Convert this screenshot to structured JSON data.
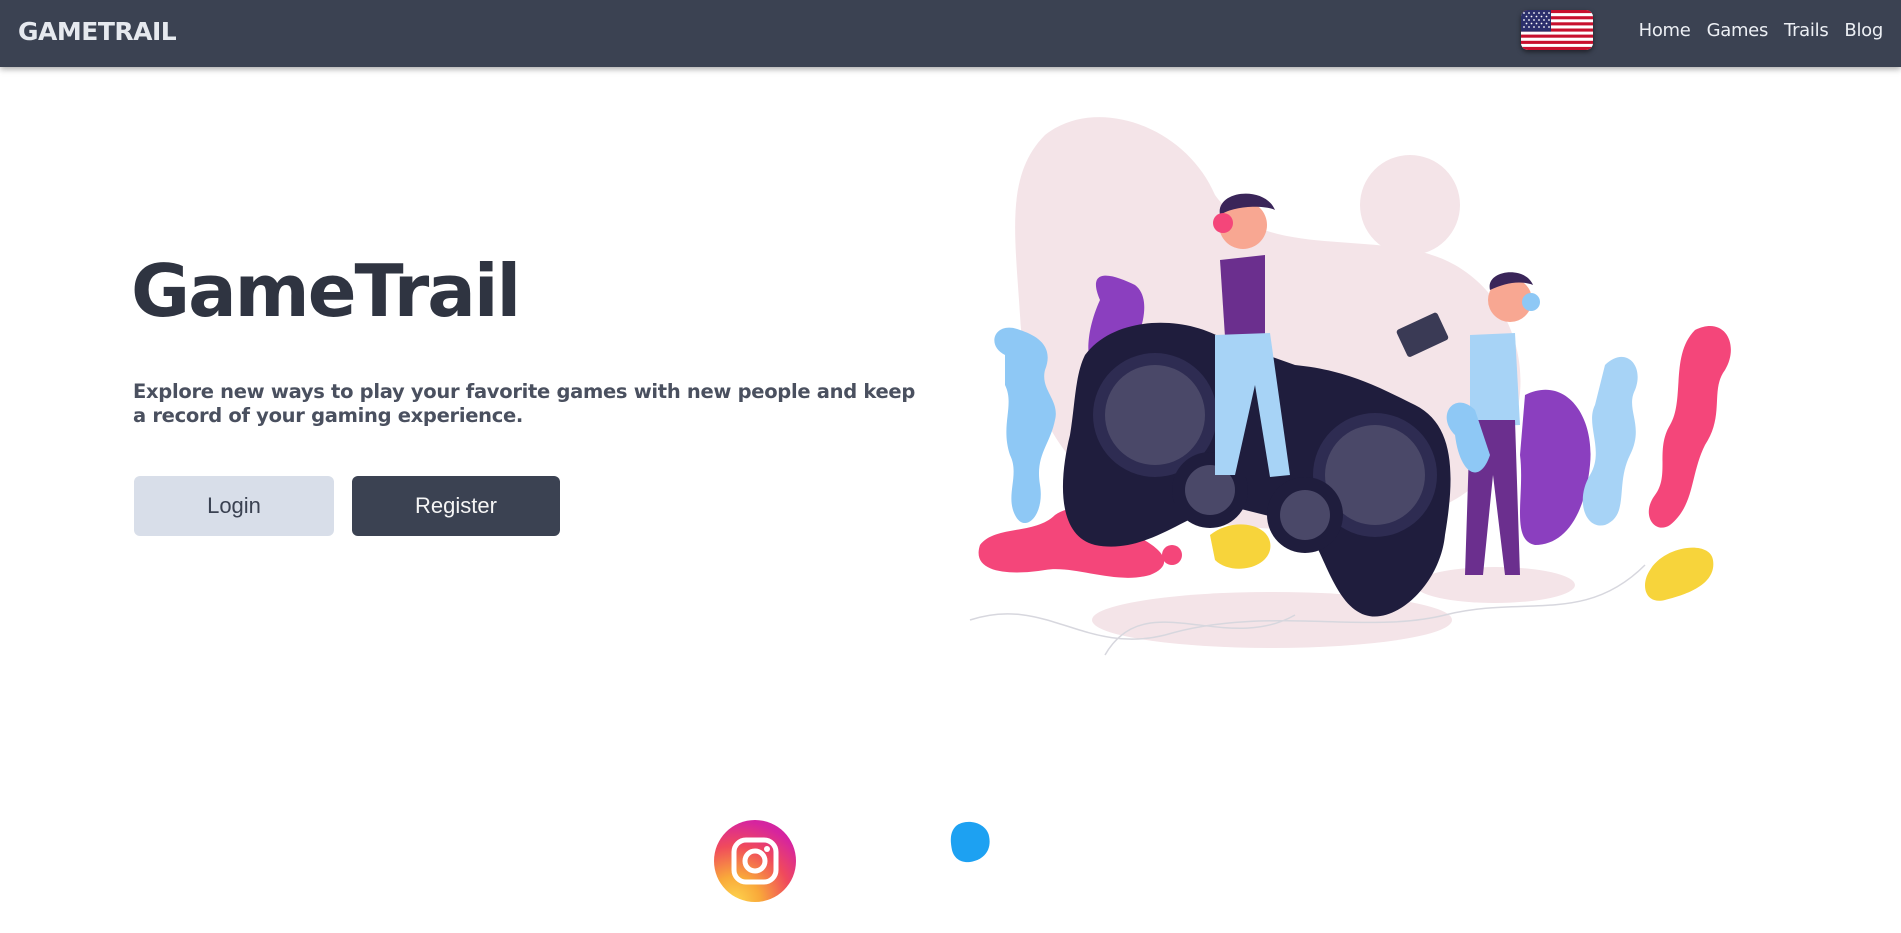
{
  "navbar": {
    "brand": "GAMETRAIL",
    "language_flag": "us-flag-icon",
    "links": [
      {
        "label": "Home"
      },
      {
        "label": "Games"
      },
      {
        "label": "Trails"
      },
      {
        "label": "Blog"
      }
    ],
    "background_color": "#3b4252"
  },
  "hero": {
    "title": "GameTrail",
    "description": "Explore new ways to play your favorite games with new people and keep a record of your gaming experience.",
    "login_label": "Login",
    "register_label": "Register",
    "illustration": "gamers-with-controller-illustration"
  },
  "social": {
    "icons": [
      "instagram-icon",
      "twitter-icon"
    ]
  }
}
